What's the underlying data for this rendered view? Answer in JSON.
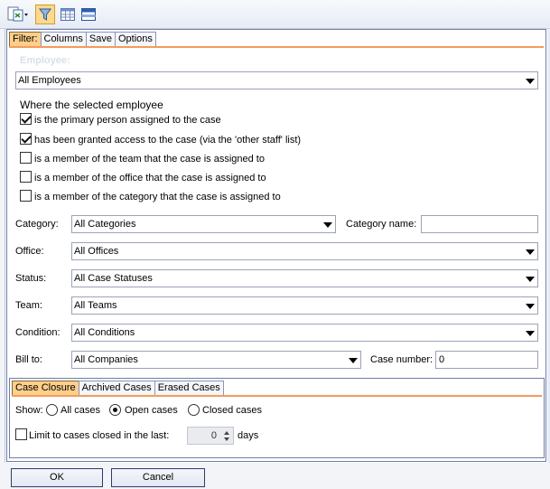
{
  "toolbar": {
    "icons": [
      "report-icon",
      "filter-icon",
      "grid-icon",
      "panel-icon"
    ]
  },
  "tabs": [
    "Filter:",
    "Columns",
    "Save",
    "Options"
  ],
  "employee": {
    "title": "Employee:",
    "selected": "All Employees",
    "where_label": "Where the selected employee",
    "options": [
      {
        "label": "is the primary person assigned to the case",
        "checked": true
      },
      {
        "label": "has been granted access to the case (via the 'other staff' list)",
        "checked": true
      },
      {
        "label": "is a member of the team that the case is assigned to",
        "checked": false
      },
      {
        "label": "is a member of the office that the case is assigned to",
        "checked": false
      },
      {
        "label": "is a member of the category that the case is assigned to",
        "checked": false
      }
    ]
  },
  "fields": {
    "category": {
      "label": "Category:",
      "value": "All Categories"
    },
    "category_name": {
      "label": "Category name:",
      "value": ""
    },
    "office": {
      "label": "Office:",
      "value": "All Offices"
    },
    "status": {
      "label": "Status:",
      "value": "All Case Statuses"
    },
    "team": {
      "label": "Team:",
      "value": "All Teams"
    },
    "condition": {
      "label": "Condition:",
      "value": "All Conditions"
    },
    "bill_to": {
      "label": "Bill to:",
      "value": "All Companies"
    },
    "case_number": {
      "label": "Case number:",
      "value": "0"
    }
  },
  "subtabs": [
    "Case Closure",
    "Archived Cases",
    "Erased Cases"
  ],
  "closure": {
    "show_label": "Show:",
    "radios": [
      {
        "label": "All cases",
        "checked": false
      },
      {
        "label": "Open cases",
        "checked": true
      },
      {
        "label": "Closed cases",
        "checked": false
      }
    ],
    "limit_label": "Limit to cases closed in the last:",
    "limit_checked": false,
    "days_value": "0",
    "days_label": "days"
  },
  "buttons": {
    "ok": "OK",
    "cancel": "Cancel"
  }
}
